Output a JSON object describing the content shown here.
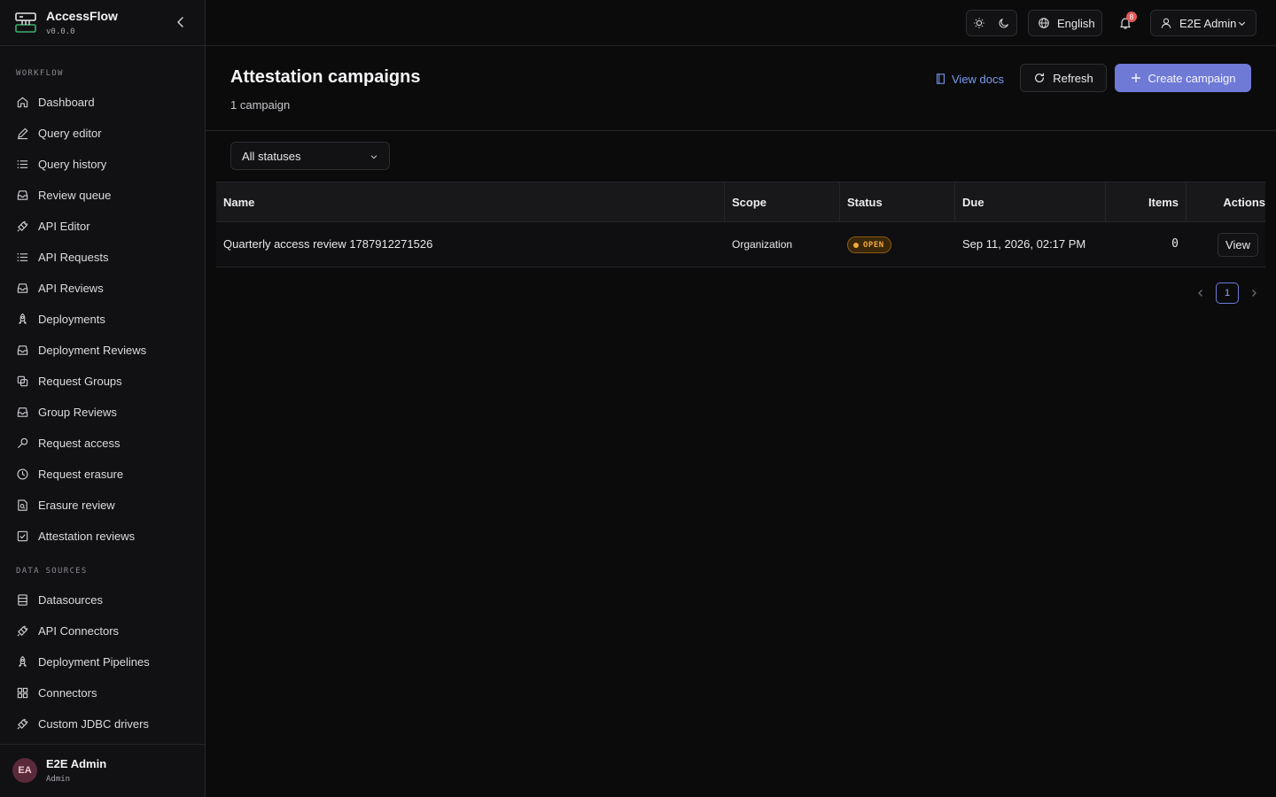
{
  "brand": {
    "name": "AccessFlow",
    "version": "v0.0.0"
  },
  "sidebar": {
    "sections": [
      {
        "label": "WORKFLOW"
      },
      {
        "label": "DATA SOURCES"
      }
    ],
    "workflow_items": [
      {
        "label": "Dashboard",
        "icon": "home-icon"
      },
      {
        "label": "Query editor",
        "icon": "pen-icon"
      },
      {
        "label": "Query history",
        "icon": "list-icon"
      },
      {
        "label": "Review queue",
        "icon": "inbox-icon"
      },
      {
        "label": "API Editor",
        "icon": "plug-icon"
      },
      {
        "label": "API Requests",
        "icon": "list-icon"
      },
      {
        "label": "API Reviews",
        "icon": "inbox-icon"
      },
      {
        "label": "Deployments",
        "icon": "rocket-icon"
      },
      {
        "label": "Deployment Reviews",
        "icon": "inbox-icon"
      },
      {
        "label": "Request Groups",
        "icon": "copy-icon"
      },
      {
        "label": "Group Reviews",
        "icon": "inbox-icon"
      },
      {
        "label": "Request access",
        "icon": "key-icon"
      },
      {
        "label": "Request erasure",
        "icon": "clock-icon"
      },
      {
        "label": "Erasure review",
        "icon": "file-search-icon"
      },
      {
        "label": "Attestation reviews",
        "icon": "check-square-icon"
      }
    ],
    "datasource_items": [
      {
        "label": "Datasources",
        "icon": "database-icon"
      },
      {
        "label": "API Connectors",
        "icon": "plug-icon"
      },
      {
        "label": "Deployment Pipelines",
        "icon": "rocket-icon"
      },
      {
        "label": "Connectors",
        "icon": "grid-icon"
      },
      {
        "label": "Custom JDBC drivers",
        "icon": "plug-icon"
      }
    ],
    "user": {
      "initials": "EA",
      "name": "E2E Admin",
      "role": "Admin"
    }
  },
  "topbar": {
    "language": "English",
    "notifications_count": "8",
    "user_name": "E2E Admin"
  },
  "page": {
    "title": "Attestation campaigns",
    "subtitle": "1 campaign",
    "view_docs": "View docs",
    "refresh": "Refresh",
    "create": "Create campaign",
    "filter_value": "All statuses"
  },
  "table": {
    "headers": {
      "name": "Name",
      "scope": "Scope",
      "status": "Status",
      "due": "Due",
      "items": "Items",
      "actions": "Actions"
    },
    "rows": [
      {
        "name": "Quarterly access review 1787912271526",
        "scope": "Organization",
        "status": "OPEN",
        "due": "Sep 11, 2026, 02:17 PM",
        "items": "0",
        "action": "View"
      }
    ]
  },
  "pagination": {
    "current": "1"
  },
  "colors": {
    "accent": "#6f7ad6",
    "status_open": "#f3a93b",
    "link": "#7b9cf0"
  }
}
